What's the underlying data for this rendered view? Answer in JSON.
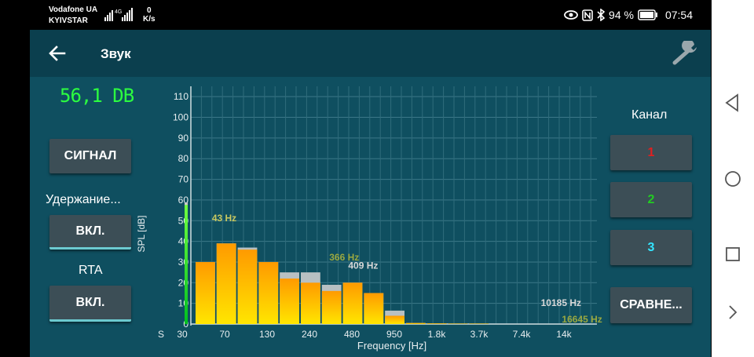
{
  "status_bar": {
    "carrier_1": "Vodafone UA",
    "carrier_2": "KYIVSTAR",
    "net_speed_value": "0",
    "net_speed_unit": "K/s",
    "battery": "94 %",
    "time": "07:54",
    "icons": [
      "signal-icon",
      "eye-icon",
      "nfc-icon",
      "bluetooth-icon",
      "battery-icon"
    ]
  },
  "app_bar": {
    "title": "Звук",
    "back_icon": "arrow-left-icon",
    "settings_icon": "wrench-icon"
  },
  "left_panel": {
    "level": "56,1 DB",
    "signal_button": "СИГНАЛ",
    "hold_label": "Удержание...",
    "hold_button": "ВКЛ.",
    "rta_label": "RTA",
    "rta_button": "ВКЛ."
  },
  "right_panel": {
    "channel_label": "Канал",
    "channels": [
      {
        "label": "1",
        "color": "#e02020"
      },
      {
        "label": "2",
        "color": "#22cc22"
      },
      {
        "label": "3",
        "color": "#33e5ff"
      }
    ],
    "compare_button": "СРАВНЕ..."
  },
  "chart_data": {
    "type": "bar",
    "ylabel": "SPL [dB]",
    "xlabel": "Frequency [Hz]",
    "ylim": [
      0,
      115
    ],
    "yticks": [
      "0",
      "10",
      "20",
      "30",
      "40",
      "50",
      "60",
      "70",
      "80",
      "90",
      "100",
      "110"
    ],
    "xtick_labels": [
      "S",
      "30",
      "70",
      "130",
      "240",
      "480",
      "950",
      "1.8k",
      "3.7k",
      "7.4k",
      "14k"
    ],
    "grid": true,
    "side_meter_value": 58,
    "values": [
      30,
      39,
      36,
      30,
      22,
      20,
      16,
      20,
      15,
      4,
      0.5,
      0.3,
      0.2,
      0.2,
      0,
      0,
      0,
      0,
      0,
      0
    ],
    "peaks": [
      30,
      39,
      37,
      30,
      25,
      25,
      19,
      20,
      15,
      6.5,
      0.5,
      0.3,
      0.2,
      0.2,
      0,
      0,
      0,
      0,
      0,
      0
    ],
    "annotations": [
      {
        "text": "43 Hz",
        "color": "#c8c860",
        "x_band": 1.4,
        "y": 49
      },
      {
        "text": "366 Hz",
        "color": "#9aa840",
        "x_band": 7.1,
        "y": 30
      },
      {
        "text": "409 Hz",
        "color": "#d8d8d8",
        "x_band": 8.0,
        "y": 26
      },
      {
        "text": "10185 Hz",
        "color": "#d8d8d8",
        "x_band": 17.4,
        "y": 8
      },
      {
        "text": "16645 Hz",
        "color": "#9aa840",
        "x_band": 18.4,
        "y": 0
      }
    ]
  }
}
